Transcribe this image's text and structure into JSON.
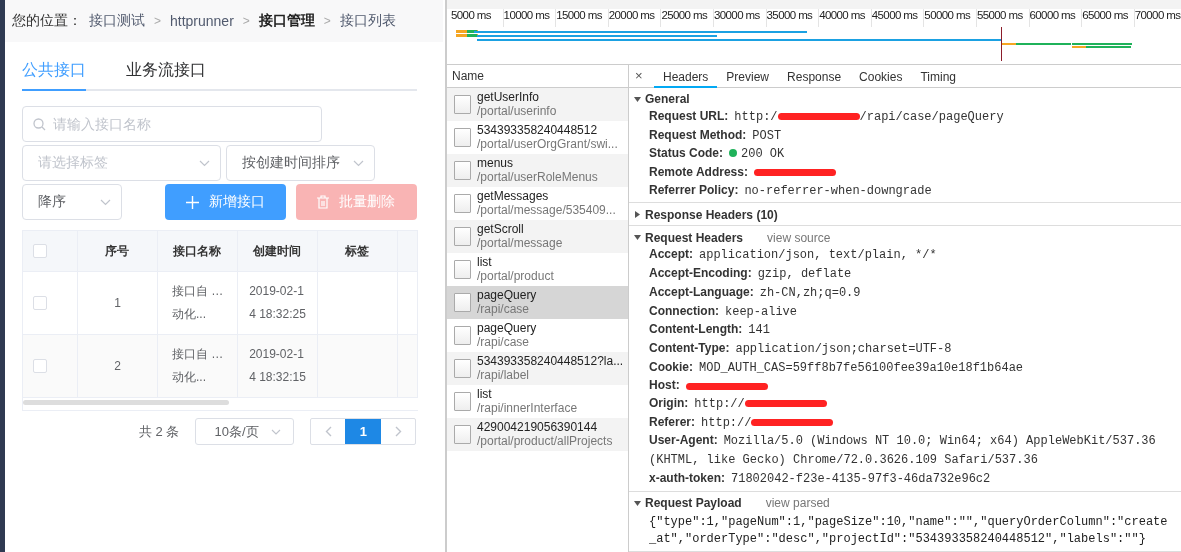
{
  "breadcrumb": {
    "label": "您的位置：",
    "separator": ">",
    "items": [
      {
        "text": "接口测试",
        "current": false
      },
      {
        "text": "httprunner",
        "current": false
      },
      {
        "text": "接口管理",
        "current": true
      },
      {
        "text": "接口列表",
        "current": false
      }
    ]
  },
  "tabs": [
    {
      "label": "公共接口",
      "selected": true
    },
    {
      "label": "业务流接口",
      "selected": false
    }
  ],
  "search": {
    "placeholder": "请输入接口名称"
  },
  "tag_select": {
    "placeholder": "请选择标签"
  },
  "sort_select": {
    "value": "按创建时间排序"
  },
  "order_select": {
    "value": "降序"
  },
  "buttons": [
    {
      "label": "新增接口",
      "kind": "add",
      "disabled": false
    },
    {
      "label": "批量删除",
      "kind": "delete",
      "disabled": true
    }
  ],
  "table": {
    "header_checked": false,
    "columns": [
      "序号",
      "接口名称",
      "创建时间",
      "标签"
    ],
    "rows": [
      {
        "checked": false,
        "index": "1",
        "name_lines": [
          "接口自 …",
          "动化..."
        ],
        "created_lines": [
          "2019-02-1",
          "4 18:32:25"
        ]
      },
      {
        "checked": false,
        "index": "2",
        "name_lines": [
          "接口自 …",
          "动化..."
        ],
        "created_lines": [
          "2019-02-1",
          "4 18:32:15"
        ]
      }
    ]
  },
  "pagination": {
    "total": "共 2 条",
    "page_size": "10条/页",
    "pages": [
      {
        "label": "1",
        "selected": true
      }
    ]
  },
  "timeline": {
    "ticks": [
      "5000 ms",
      "10000 ms",
      "15000 ms",
      "20000 ms",
      "25000 ms",
      "30000 ms",
      "35000 ms",
      "40000 ms",
      "45000 ms",
      "50000 ms",
      "55000 ms",
      "60000 ms",
      "65000 ms",
      "70000 ms"
    ]
  },
  "name_header": "Name",
  "requests": [
    {
      "name": "getUserInfo",
      "path": "/portal/userinfo",
      "selected": false
    },
    {
      "name": "534393358240448512",
      "path": "/portal/userOrgGrant/swi...",
      "selected": false
    },
    {
      "name": "menus",
      "path": "/portal/userRoleMenus",
      "selected": false
    },
    {
      "name": "getMessages",
      "path": "/portal/message/535409...",
      "selected": false
    },
    {
      "name": "getScroll",
      "path": "/portal/message",
      "selected": false
    },
    {
      "name": "list",
      "path": "/portal/product",
      "selected": false
    },
    {
      "name": "pageQuery",
      "path": "/rapi/case",
      "selected": true
    },
    {
      "name": "pageQuery",
      "path": "/rapi/case",
      "selected": false
    },
    {
      "name": "534393358240448512?la...",
      "path": "/rapi/label",
      "selected": false
    },
    {
      "name": "list",
      "path": "/rapi/innerInterface",
      "selected": false
    },
    {
      "name": "429004219056390144",
      "path": "/portal/product/allProjects",
      "selected": false
    }
  ],
  "detail_close": "×",
  "detail_tabs": [
    {
      "label": "Headers",
      "selected": true
    },
    {
      "label": "Preview",
      "selected": false
    },
    {
      "label": "Response",
      "selected": false
    },
    {
      "label": "Cookies",
      "selected": false
    },
    {
      "label": "Timing",
      "selected": false
    }
  ],
  "sections": [
    {
      "title": "General",
      "expanded": true,
      "rows": [
        {
          "kind": "redacted",
          "key": "Request URL:",
          "value": "http:/",
          "value_after": "/rapi/case/pageQuery"
        },
        {
          "kind": "plain",
          "key": "Request Method:",
          "value": "POST"
        },
        {
          "kind": "status",
          "key": "Status Code:",
          "value": "200 OK"
        },
        {
          "kind": "redacted",
          "key": "Remote Address:"
        },
        {
          "kind": "plain",
          "key": "Referrer Policy:",
          "value": "no-referrer-when-downgrade"
        }
      ]
    },
    {
      "title": "Response Headers (10)",
      "expanded": false
    },
    {
      "title": "Request Headers",
      "link": "view source",
      "expanded": true,
      "rows": [
        {
          "kind": "plain",
          "key": "Accept:",
          "value": "application/json, text/plain, */*"
        },
        {
          "kind": "plain",
          "key": "Accept-Encoding:",
          "value": "gzip, deflate"
        },
        {
          "kind": "plain",
          "key": "Accept-Language:",
          "value": "zh-CN,zh;q=0.9"
        },
        {
          "kind": "plain",
          "key": "Connection:",
          "value": "keep-alive"
        },
        {
          "kind": "plain",
          "key": "Content-Length:",
          "value": "141"
        },
        {
          "kind": "plain",
          "key": "Content-Type:",
          "value": "application/json;charset=UTF-8"
        },
        {
          "kind": "plain",
          "key": "Cookie:",
          "value": "MOD_AUTH_CAS=59ff8b7fe56100fee39a10e18f1b64ae"
        },
        {
          "kind": "redacted",
          "key": "Host:"
        },
        {
          "kind": "redacted",
          "key": "Origin:",
          "value": "http://"
        },
        {
          "kind": "redacted",
          "key": "Referer:",
          "value": "http://"
        },
        {
          "kind": "plain",
          "key": "User-Agent:",
          "value": "Mozilla/5.0 (Windows NT 10.0; Win64; x64) AppleWebKit/537.36 (KHTML, like Gecko) Chrome/72.0.3626.109 Safari/537.36"
        },
        {
          "kind": "plain",
          "key": "x-auth-token:",
          "value": "71802042-f23e-4135-97f3-46da732e96c2"
        }
      ]
    },
    {
      "title": "Request Payload",
      "link": "view parsed",
      "expanded": true,
      "payload": "{\"type\":1,\"pageNum\":1,\"pageSize\":10,\"name\":\"\",\"queryOrderColumn\":\"create_at\",\"orderType\":\"desc\",\"projectId\":\"534393358240448512\",\"labels\":\"\"}"
    }
  ]
}
